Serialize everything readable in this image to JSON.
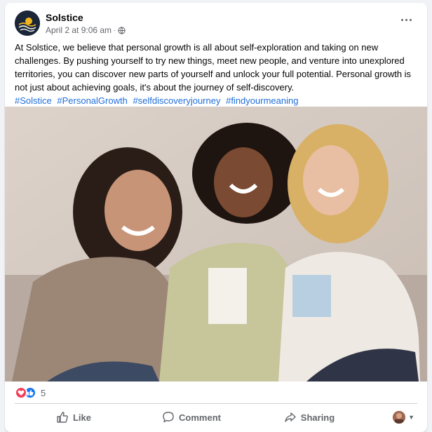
{
  "post": {
    "page_name": "Solstice",
    "timestamp": "April 2 at 9:06 am",
    "separator": "·",
    "body": "At Solstice, we believe that personal growth is all about self-exploration and taking on new challenges. By pushing yourself to try new things, meet new people, and venture into unexplored territories, you can discover new parts of yourself and unlock your full potential. Personal growth is not just about achieving goals, it's about the journey of self-discovery.",
    "hashtags": [
      "#Solstice",
      "#PersonalGrowth",
      "#selfdiscoveryjourney",
      "#findyourmeaning"
    ],
    "icons": {
      "privacy": "globe-icon",
      "more": "more-options-icon"
    }
  },
  "reactions": {
    "types": [
      "love",
      "like"
    ],
    "count": "5",
    "colors": {
      "love": "#f33e58",
      "like": "#1877f2"
    }
  },
  "actions": {
    "like_label": "Like",
    "comment_label": "Comment",
    "share_label": "Sharing"
  },
  "colors": {
    "link": "#216fdb",
    "secondary_text": "#65676b",
    "card": "#ffffff"
  }
}
